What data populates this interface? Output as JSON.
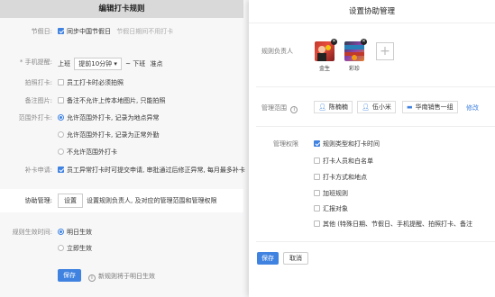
{
  "left": {
    "title": "编辑打卡规则",
    "holiday": {
      "label": "节假日:",
      "check_text": "同步中国节假日",
      "hint": "节假日期间不用打卡"
    },
    "reminder": {
      "label": "* 手机提醒:",
      "prefix": "上班",
      "select_value": "提前10分钟",
      "mid": "~ 下班",
      "suffix": "准点"
    },
    "photo_punch": {
      "label": "拍照打卡:",
      "text": "员工打卡时必须拍照"
    },
    "remark_photo": {
      "label": "备注图片:",
      "text": "备注不允许上传本地图片, 只能拍照"
    },
    "out_of_range": {
      "label": "范围外打卡:",
      "options": [
        "允许范围外打卡, 记录为地点异常",
        "允许范围外打卡, 记录为正常外勤",
        "不允许范围外打卡"
      ]
    },
    "makeup": {
      "label": "补卡申请:",
      "text": "员工异常打卡时可提交申请, 审批通过后修正异常, 每月最多补卡"
    },
    "collab": {
      "label": "协助管理:",
      "button": "设置",
      "text": "设置规则负责人, 及对应的管理范围和管理权限"
    },
    "effective": {
      "label": "规则生效时间:",
      "options": [
        "明日生效",
        "立即生效"
      ]
    },
    "save": "保存",
    "footer_hint": "新规则将于明日生效"
  },
  "modal": {
    "title": "设置协助管理",
    "owner_label": "规则负责人",
    "owners": [
      {
        "name": "金生",
        "color": "#c0392b"
      },
      {
        "name": "彩珍",
        "color": "#34495e"
      }
    ],
    "add_symbol": "+",
    "scope_label": "管理范围",
    "scope_tags": [
      "陈楠楠",
      "伍小米",
      "华南销售一组"
    ],
    "scope_edit": "修改",
    "perm_label": "管理权限",
    "permissions": [
      {
        "text": "规则类型和打卡时间",
        "checked": true
      },
      {
        "text": "打卡人员和白名单",
        "checked": false
      },
      {
        "text": "打卡方式和地点",
        "checked": false
      },
      {
        "text": "加班规则",
        "checked": false
      },
      {
        "text": "汇报对象",
        "checked": false
      },
      {
        "text": "其他 (特殊日期、节假日、手机提醒、拍照打卡、备注",
        "checked": false
      }
    ],
    "ok": "保存",
    "cancel": "取消"
  }
}
